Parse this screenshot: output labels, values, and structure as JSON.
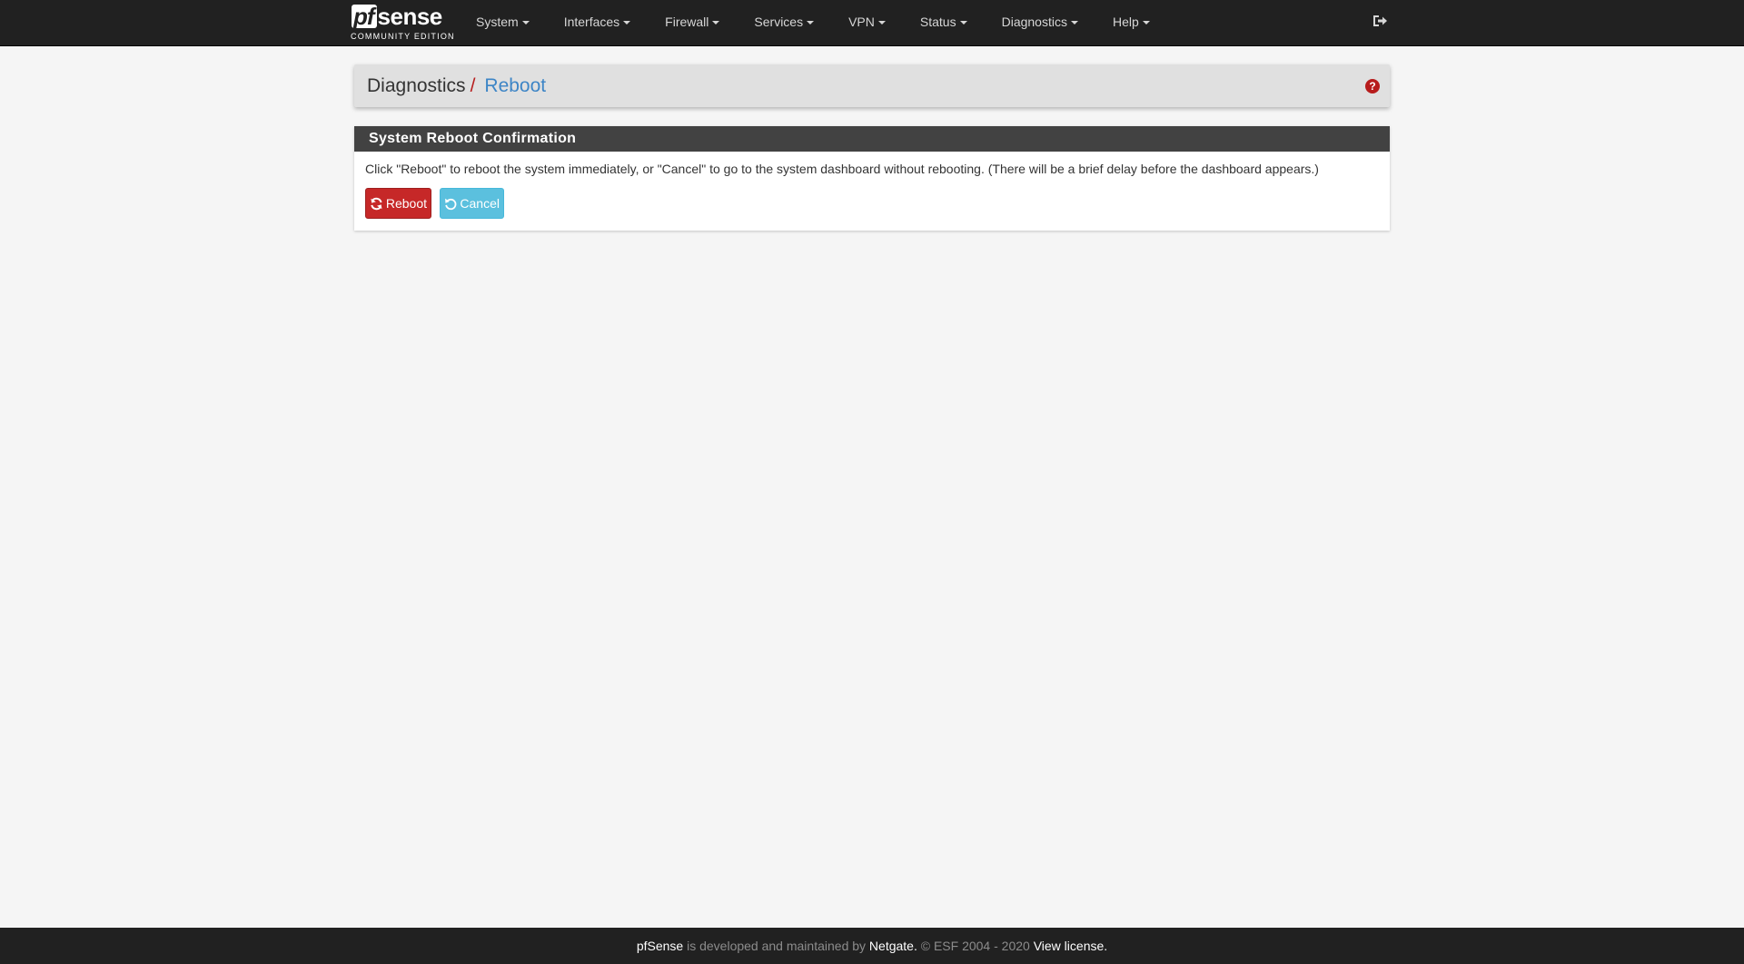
{
  "brand": {
    "logo_pf": "pf",
    "logo_sense": "sense",
    "edition": "COMMUNITY EDITION"
  },
  "nav": {
    "items": [
      {
        "label": "System"
      },
      {
        "label": "Interfaces"
      },
      {
        "label": "Firewall"
      },
      {
        "label": "Services"
      },
      {
        "label": "VPN"
      },
      {
        "label": "Status"
      },
      {
        "label": "Diagnostics"
      },
      {
        "label": "Help"
      }
    ],
    "logout_icon": "sign-out-icon"
  },
  "header": {
    "breadcrumb_section": "Diagnostics",
    "breadcrumb_separator": "/",
    "breadcrumb_page": "Reboot",
    "help_icon": "question-circle-icon",
    "help_glyph": "?"
  },
  "panel": {
    "title": "System Reboot Confirmation",
    "message": "Click \"Reboot\" to reboot the system immediately, or \"Cancel\" to go to the system dashboard without rebooting. (There will be a brief delay before the dashboard appears.)",
    "reboot_label": "Reboot",
    "cancel_label": "Cancel"
  },
  "footer": {
    "product": "pfSense",
    "text_1": " is developed and maintained by ",
    "company": "Netgate.",
    "copyright": " © ESF 2004 - 2020 ",
    "license_link": "View license."
  },
  "colors": {
    "navbar_bg": "#212121",
    "reboot_button": "#c62828",
    "cancel_button": "#5bc0de",
    "breadcrumb_link": "#3d85c6",
    "panel_heading": "#424242"
  }
}
